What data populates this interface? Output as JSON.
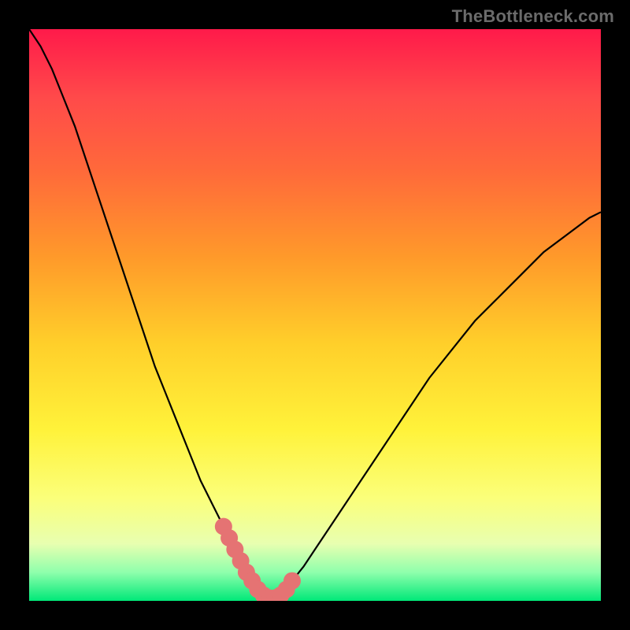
{
  "watermark": "TheBottleneck.com",
  "colors": {
    "background": "#000000",
    "curve_stroke": "#000000",
    "marker_fill": "#e57373",
    "gradient_top": "#ff1a4a",
    "gradient_bottom": "#00e878"
  },
  "chart_data": {
    "type": "line",
    "title": "",
    "xlabel": "",
    "ylabel": "",
    "xlim": [
      0,
      100
    ],
    "ylim": [
      0,
      100
    ],
    "grid": false,
    "legend": false,
    "series": [
      {
        "name": "bottleneck-curve",
        "x": [
          0,
          2,
          4,
          6,
          8,
          10,
          12,
          14,
          16,
          18,
          20,
          22,
          24,
          26,
          28,
          30,
          32,
          34,
          36,
          37,
          38,
          39,
          40,
          41,
          42,
          43,
          44,
          45,
          46,
          48,
          50,
          52,
          54,
          56,
          58,
          60,
          62,
          64,
          66,
          68,
          70,
          74,
          78,
          82,
          86,
          90,
          94,
          98,
          100
        ],
        "values": [
          100,
          97,
          93,
          88,
          83,
          77,
          71,
          65,
          59,
          53,
          47,
          41,
          36,
          31,
          26,
          21,
          17,
          13,
          9,
          7,
          5,
          3.5,
          2,
          1,
          0.5,
          0.5,
          1,
          2,
          3.5,
          6,
          9,
          12,
          15,
          18,
          21,
          24,
          27,
          30,
          33,
          36,
          39,
          44,
          49,
          53,
          57,
          61,
          64,
          67,
          68
        ]
      }
    ],
    "markers": {
      "name": "highlight-dots",
      "x": [
        34,
        35,
        36,
        37,
        38,
        39,
        40,
        41,
        42,
        43,
        44,
        45,
        46
      ],
      "values": [
        13,
        11,
        9,
        7,
        5,
        3.5,
        2,
        1,
        0.5,
        0.5,
        1,
        2,
        3.5
      ],
      "size": 11
    }
  }
}
